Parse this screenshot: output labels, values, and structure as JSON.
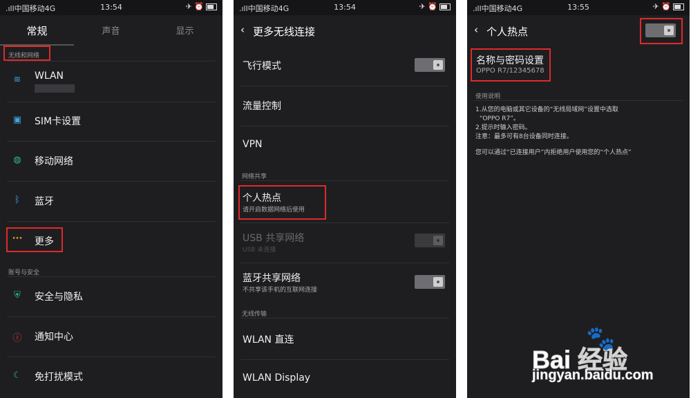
{
  "statusbar": {
    "carrier": ".ıll中国移动4G",
    "wifi_icon": "wifi-icon",
    "time1": "13:54",
    "time2": "13:54",
    "time3": "13:55",
    "right_icons": "✈ ⏰"
  },
  "screen1": {
    "tabs": [
      "常规",
      "声音",
      "显示"
    ],
    "section_network": "无线和网络",
    "section_account": "账号与安全",
    "items": [
      {
        "label": "WLAN",
        "icon": "wifi-icon"
      },
      {
        "label": "SIM卡设置",
        "icon": "sim-icon"
      },
      {
        "label": "移动网络",
        "icon": "globe-icon"
      },
      {
        "label": "蓝牙",
        "icon": "bluetooth-icon"
      },
      {
        "label": "更多",
        "icon": "more-icon"
      },
      {
        "label": "安全与隐私",
        "icon": "shield-icon"
      },
      {
        "label": "通知中心",
        "icon": "alert-icon"
      },
      {
        "label": "免打扰模式",
        "icon": "moon-icon"
      }
    ]
  },
  "screen2": {
    "title": "更多无线连接",
    "airplane": "飞行模式",
    "data_control": "流量控制",
    "vpn": "VPN",
    "section_share": "网络共享",
    "hotspot": "个人热点",
    "hotspot_sub": "请开启数据网络后使用",
    "usb": "USB 共享网络",
    "usb_sub": "USB 未连接",
    "bt_share": "蓝牙共享网络",
    "bt_share_sub": "不共享该手机的互联网连接",
    "section_transfer": "无线传输",
    "wlan_direct": "WLAN 直连",
    "wlan_display": "WLAN Display"
  },
  "screen3": {
    "title": "个人热点",
    "name_pw": "名称与密码设置",
    "name_pw_value": "OPPO R7/12345678",
    "section_help": "使用说明",
    "line1": "1.从您的电脑或其它设备的“无线局域网”设置中选取",
    "line2": "“OPPO R7”。",
    "line3": "2.提示时输入密码。",
    "line4": "注意：最多可有8台设备同时连接。",
    "line5": "您可以通过“已连接用户”内拒绝用户使用您的“个人热点”"
  },
  "watermark": {
    "logo": "Bai  经验",
    "url": "jingyan.baidu.com"
  },
  "colors": {
    "highlight": "#e02a2a",
    "background": "#1e1e21"
  }
}
